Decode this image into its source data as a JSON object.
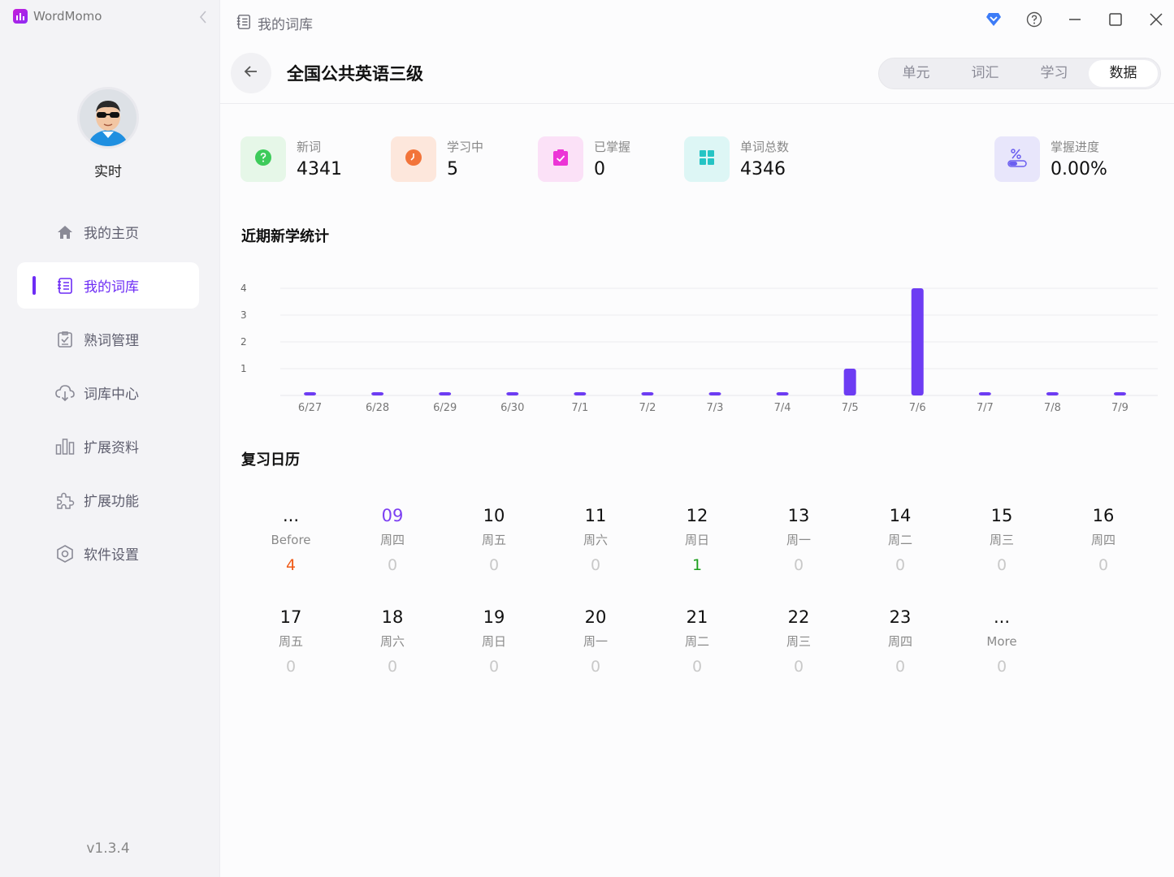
{
  "app": {
    "name": "WordMomo",
    "version": "v1.3.4"
  },
  "user": {
    "name": "实时"
  },
  "sidebar": {
    "items": [
      {
        "label": "我的主页",
        "icon": "home-icon"
      },
      {
        "label": "我的词库",
        "icon": "notebook-icon",
        "active": true
      },
      {
        "label": "熟词管理",
        "icon": "clipboard-check-icon"
      },
      {
        "label": "词库中心",
        "icon": "cloud-download-icon"
      },
      {
        "label": "扩展资料",
        "icon": "bar-chart-icon"
      },
      {
        "label": "扩展功能",
        "icon": "puzzle-icon"
      },
      {
        "label": "软件设置",
        "icon": "settings-hex-icon"
      }
    ]
  },
  "titlebar": {
    "breadcrumb": "我的词库"
  },
  "header": {
    "title": "全国公共英语三级",
    "tabs": [
      {
        "label": "单元"
      },
      {
        "label": "词汇"
      },
      {
        "label": "学习"
      },
      {
        "label": "数据",
        "active": true
      }
    ]
  },
  "stats": [
    {
      "label": "新词",
      "value": "4341",
      "icon": "question-circle-icon",
      "bg": "#e6f7e8",
      "fg": "#3dcb5a"
    },
    {
      "label": "学习中",
      "value": "5",
      "icon": "clock-icon",
      "bg": "#fde7dc",
      "fg": "#f2743a"
    },
    {
      "label": "已掌握",
      "value": "0",
      "icon": "checklist-icon",
      "bg": "#fbe1f7",
      "fg": "#ec35d6"
    },
    {
      "label": "单词总数",
      "value": "4346",
      "icon": "grid-icon",
      "bg": "#ddf6f5",
      "fg": "#25c4c4"
    },
    {
      "label": "掌握进度",
      "value": "0.00%",
      "icon": "percent-toggle-icon",
      "bg": "#e8e6fb",
      "fg": "#6b5ff0"
    }
  ],
  "recent_section": {
    "title": "近期新学统计"
  },
  "chart_data": {
    "type": "bar",
    "categories": [
      "6/27",
      "6/28",
      "6/29",
      "6/30",
      "7/1",
      "7/2",
      "7/3",
      "7/4",
      "7/5",
      "7/6",
      "7/7",
      "7/8",
      "7/9"
    ],
    "values": [
      0,
      0,
      0,
      0,
      0,
      0,
      0,
      0,
      1,
      4,
      0,
      0,
      0
    ],
    "yticks": [
      1,
      2,
      3,
      4
    ],
    "ylim": [
      0,
      4
    ],
    "grid": true,
    "bar_color": "#6d3cf3"
  },
  "calendar": {
    "title": "复习日历",
    "days": [
      {
        "day": "...",
        "week": "Before",
        "count": "4",
        "color": "#f05a17"
      },
      {
        "day": "09",
        "week": "周四",
        "count": "0",
        "today": true
      },
      {
        "day": "10",
        "week": "周五",
        "count": "0"
      },
      {
        "day": "11",
        "week": "周六",
        "count": "0"
      },
      {
        "day": "12",
        "week": "周日",
        "count": "1",
        "color": "#1c9e1c"
      },
      {
        "day": "13",
        "week": "周一",
        "count": "0"
      },
      {
        "day": "14",
        "week": "周二",
        "count": "0"
      },
      {
        "day": "15",
        "week": "周三",
        "count": "0"
      },
      {
        "day": "16",
        "week": "周四",
        "count": "0"
      },
      {
        "day": "17",
        "week": "周五",
        "count": "0"
      },
      {
        "day": "18",
        "week": "周六",
        "count": "0"
      },
      {
        "day": "19",
        "week": "周日",
        "count": "0"
      },
      {
        "day": "20",
        "week": "周一",
        "count": "0"
      },
      {
        "day": "21",
        "week": "周二",
        "count": "0"
      },
      {
        "day": "22",
        "week": "周三",
        "count": "0"
      },
      {
        "day": "23",
        "week": "周四",
        "count": "0"
      },
      {
        "day": "...",
        "week": "More",
        "count": "0"
      }
    ]
  }
}
